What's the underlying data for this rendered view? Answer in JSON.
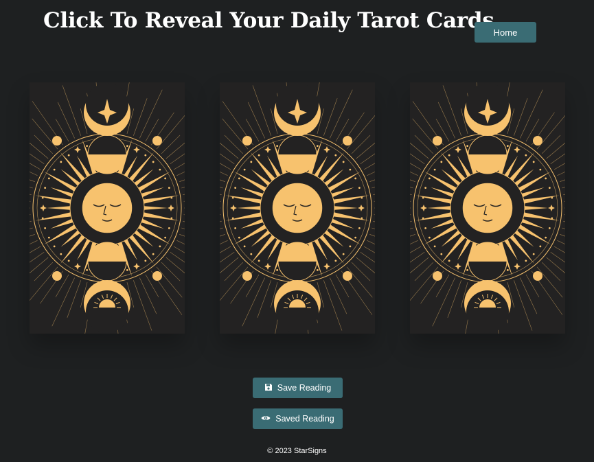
{
  "header": {
    "title": "Click To Reveal Your Daily Tarot Cards",
    "home_label": "Home"
  },
  "cards": [
    {
      "icon": "sun-moon-phases-card-back"
    },
    {
      "icon": "sun-moon-phases-card-back"
    },
    {
      "icon": "sun-moon-phases-card-back"
    }
  ],
  "actions": {
    "save_label": "Save Reading",
    "save_icon": "floppy-disk-icon",
    "saved_label": "Saved Reading",
    "saved_icon": "eye-icon"
  },
  "footer": {
    "text": "© 2023 StarSigns"
  },
  "colors": {
    "background": "#1e2021",
    "button": "#3a6c74",
    "card_background": "#232222",
    "card_gold": "#f7c26e"
  }
}
